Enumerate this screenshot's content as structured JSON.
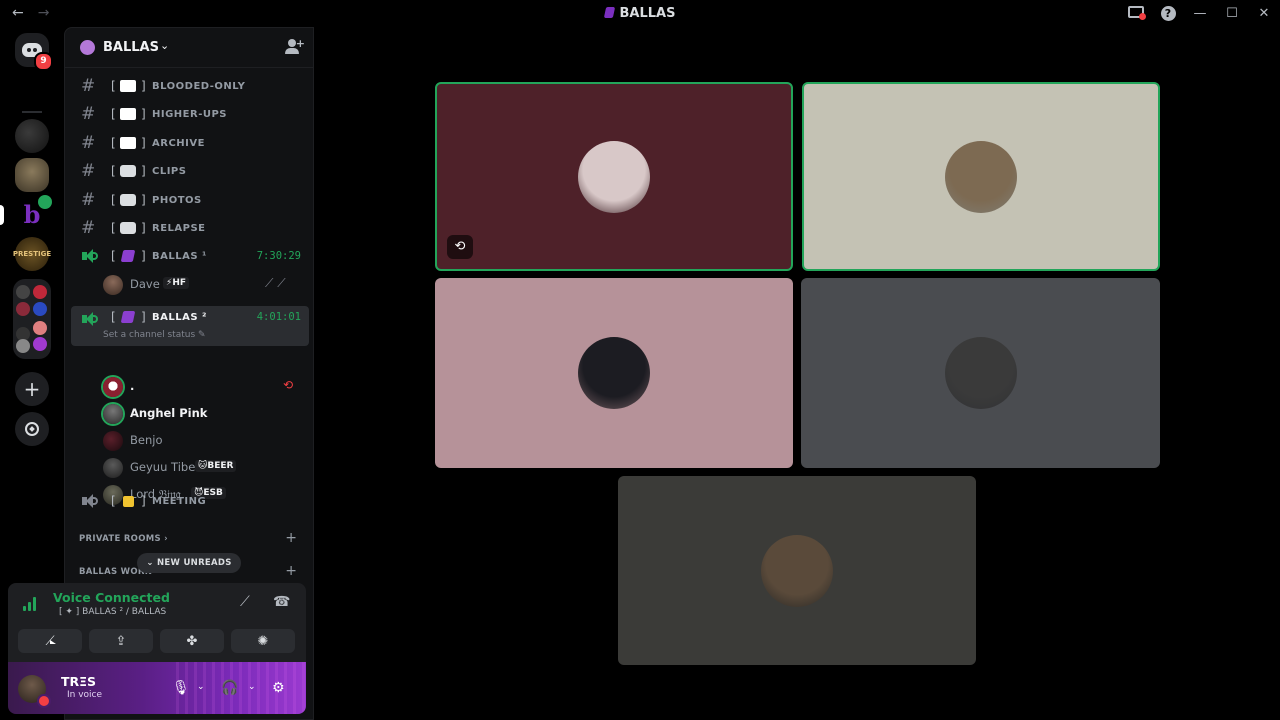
{
  "titlebar": {
    "title": "BALLAS",
    "back": "←",
    "forward": "→",
    "minimize": "—",
    "maximize": "☐",
    "close": "✕",
    "help": "?"
  },
  "rail": {
    "home_badge": "9",
    "server_3_letter": "b",
    "prestige_text": "PRESTIGE",
    "add": "+"
  },
  "guild": {
    "name": "BALLAS",
    "chevron": "⌄"
  },
  "text_channels": [
    {
      "name": "BLOODED-ONLY",
      "hash": "#",
      "open": "[",
      "close": "]"
    },
    {
      "name": "HIGHER-UPS",
      "hash": "#",
      "open": "[",
      "close": "]"
    },
    {
      "name": "ARCHIVE",
      "hash": "#",
      "open": "[",
      "close": "]"
    },
    {
      "name": "CLIPS",
      "hash": "#",
      "open": "[",
      "close": "]"
    },
    {
      "name": "PHOTOS",
      "hash": "#",
      "open": "[",
      "close": "]"
    },
    {
      "name": "RELAPSE",
      "hash": "#",
      "open": "[",
      "close": "]"
    }
  ],
  "voice_channels": [
    {
      "name": "BALLAS ¹",
      "time": "7:30:29",
      "open": "[",
      "close": "]"
    },
    {
      "name": "BALLAS ²",
      "time": "4:01:01",
      "status": "Set a channel status ✎",
      "open": "[",
      "close": "]"
    },
    {
      "name": "MEETING",
      "open": "[",
      "close": "]"
    }
  ],
  "voice1_users": [
    {
      "name": "Dave",
      "tag": "⚡HF",
      "icons": "⟋ ⟋"
    }
  ],
  "voice2_users": [
    {
      "name": ".",
      "icon": "⟲"
    },
    {
      "name": "Anghel Pink"
    },
    {
      "name": "Benjo"
    },
    {
      "name": "Geyuu Tibe",
      "tag": "🐱BEER"
    },
    {
      "name": "Lord 𝔅𝔦𝔫𝔤",
      "tag": "😈ESB"
    }
  ],
  "categories": {
    "private_rooms": "PRIVATE ROOMS ›",
    "ballas_work": "BALLAS WORK",
    "plus": "+"
  },
  "new_unreads": "⌄  NEW UNREADS",
  "voice_panel": {
    "title": "Voice Connected",
    "subtitle": "[ ✦ ] BALLAS ² / BALLAS",
    "noise_icon": "⟋",
    "disconnect_icon": "☎",
    "buttons": [
      "⟋",
      "⇪",
      "✤",
      "✺"
    ]
  },
  "user_panel": {
    "name": "TRΞS",
    "status": "In voice",
    "mic": "🎙",
    "headset": "🎧",
    "chevron": "⌄",
    "settings": "⚙"
  },
  "tiles": [
    {
      "bg": "#4e2129",
      "speaking": true,
      "badge": "⟲",
      "avatar": "#d8c8c8"
    },
    {
      "bg": "#c4c2b4",
      "speaking": true,
      "avatar": "#7d6a52"
    },
    {
      "bg": "#b69299",
      "speaking": false,
      "avatar": "#1c1c22"
    },
    {
      "bg": "#4a4c50",
      "speaking": false,
      "avatar": "#3a3a3a"
    },
    {
      "bg": "#3b3b38",
      "speaking": false,
      "avatar": "#5a4a3a"
    }
  ],
  "colors": {
    "accent_green": "#23a55a",
    "danger_red": "#f23f43",
    "brand_purple": "#7b2fbf"
  }
}
